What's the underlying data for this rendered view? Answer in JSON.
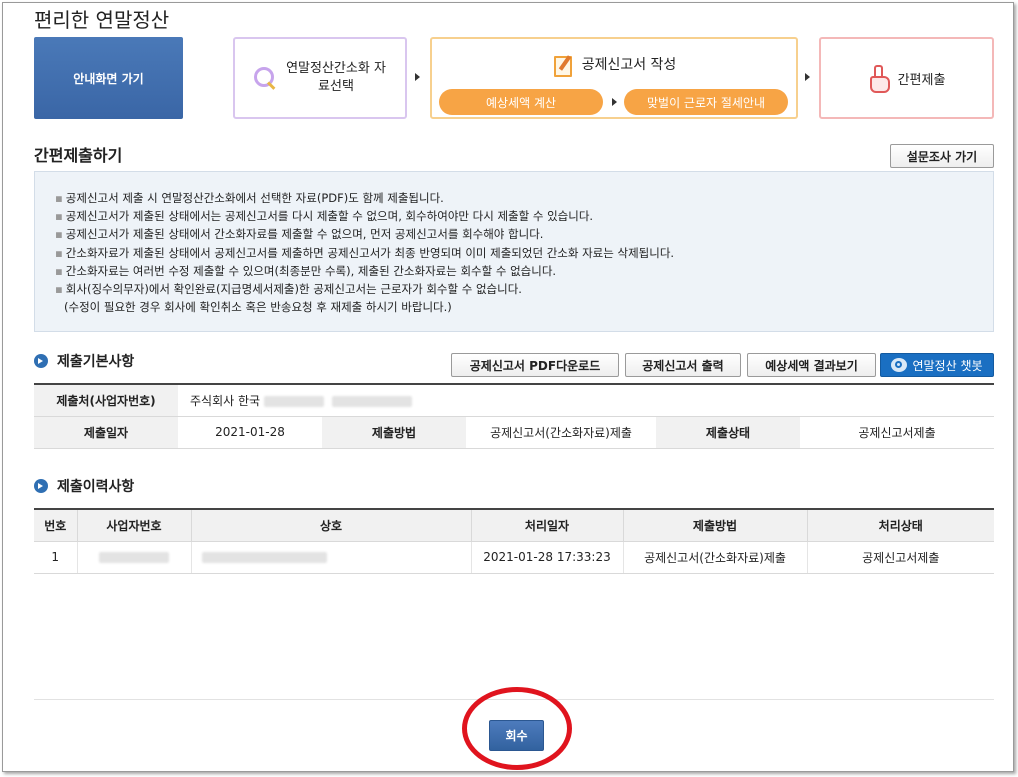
{
  "page": {
    "title": "편리한 연말정산"
  },
  "steps": {
    "home_label": "안내화면 가기",
    "step1_label": "연말정산간소화 자료선택",
    "step2_title": "공제신고서 작성",
    "step2_pill1": "예상세액 계산",
    "step2_pill2": "맞벌이 근로자 절세안내",
    "step3_label": "간편제출"
  },
  "section": {
    "title": "간편제출하기",
    "survey_button": "설문조사 가기"
  },
  "notice": {
    "lines": [
      "공제신고서 제출 시 연말정산간소화에서 선택한 자료(PDF)도 함께 제출됩니다.",
      "공제신고서가 제출된 상태에서는 공제신고서를 다시 제출할 수 없으며, 회수하여야만 다시 제출할 수 있습니다.",
      "공제신고서가 제출된 상태에서 간소화자료를 제출할 수 없으며, 먼저 공제신고서를 회수해야 합니다.",
      "간소화자료가 제출된 상태에서 공제신고서를 제출하면 공제신고서가 최종 반영되며 이미 제출되었던 간소화 자료는 삭제됩니다.",
      "간소화자료는 여러번 수정 제출할 수 있으며(최종분만 수록), 제출된 간소화자료는 회수할 수 없습니다.",
      "회사(징수의무자)에서 확인완료(지급명세서제출)한 공제신고서는 근로자가 회수할 수 없습니다."
    ],
    "last_line": "(수정이 필요한 경우 회사에 확인취소 혹은 반송요청 후 재제출 하시기 바랍니다.)"
  },
  "basic": {
    "title": "제출기본사항",
    "pdf_button": "공제신고서 PDF다운로드",
    "print_button": "공제신고서 출력",
    "result_button": "예상세액 결과보기",
    "chatbot_button": "연말정산 챗봇",
    "submitter_label": "제출처(사업자번호)",
    "submitter_value": "주식회사 한국",
    "date_label": "제출일자",
    "date_value": "2021-01-28",
    "method_label": "제출방법",
    "method_value": "공제신고서(간소화자료)제출",
    "status_label": "제출상태",
    "status_value": "공제신고서제출"
  },
  "history": {
    "title": "제출이력사항",
    "columns": [
      "번호",
      "사업자번호",
      "상호",
      "처리일자",
      "제출방법",
      "처리상태"
    ],
    "rows": [
      {
        "no": "1",
        "date": "2021-01-28 17:33:23",
        "method": "공제신고서(간소화자료)제출",
        "status": "공제신고서제출"
      }
    ]
  },
  "footer": {
    "cancel_button": "회수"
  },
  "colors": {
    "home": "#3a66a6",
    "pill": "#f7a445",
    "chatbot": "#1a6fc2",
    "highlight": "#e0141e"
  }
}
